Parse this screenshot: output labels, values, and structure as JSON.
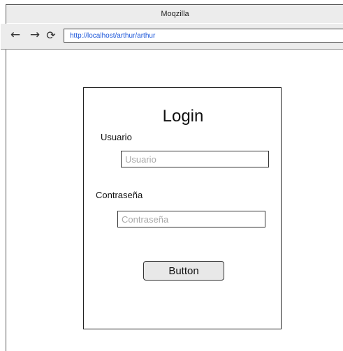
{
  "browser": {
    "title": "Moqzilla",
    "url": "http://localhost/arthur/arthur",
    "icons": {
      "back": "arrow-left-icon",
      "forward": "arrow-right-icon",
      "reload": "reload-icon"
    }
  },
  "login": {
    "title": "Login",
    "username_label": "Usuario",
    "username_placeholder": "Usuario",
    "password_label": "Contraseña",
    "password_placeholder": "Contraseña",
    "button_label": "Button"
  }
}
